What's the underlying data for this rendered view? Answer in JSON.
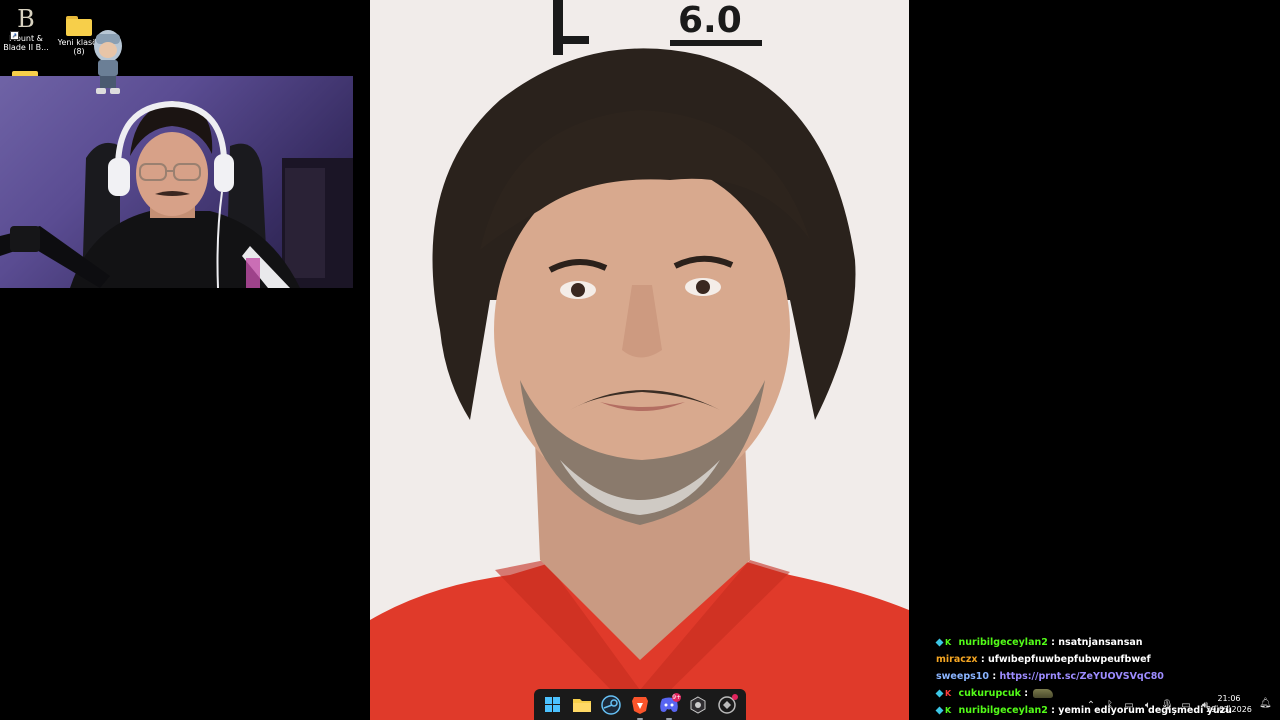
{
  "desktop": {
    "icons": [
      {
        "label": "Mount & Blade II B...",
        "icon": "mount-blade-icon"
      },
      {
        "label": "Yeni klasör (8)",
        "icon": "folder-icon"
      }
    ]
  },
  "chat": {
    "messages": [
      {
        "user": "nuribilgeceylan2",
        "user_color": "#53fc18",
        "badge": "kick-green",
        "sep": ":",
        "text": "nsatnjansansan"
      },
      {
        "user": "miraczx",
        "user_color": "#f5a623",
        "badge": "",
        "sep": ":",
        "text": "ufwıbepfıuwbepfubwpeufbwef"
      },
      {
        "user": "sweeps10",
        "user_color": "#8ab4ff",
        "badge": "",
        "sep": ":",
        "text": "https://prnt.sc/ZeYUOVSVqC80",
        "is_link": true
      },
      {
        "user": "cukurupcuk",
        "user_color": "#53fc18",
        "badge": "kick-red",
        "sep": ":",
        "text": "",
        "emote": "tank-emote"
      },
      {
        "user": "nuribilgeceylan2",
        "user_color": "#53fc18",
        "badge": "kick-green",
        "sep": ":",
        "text": "yemin ediyorum değişmedi yüzü"
      }
    ]
  },
  "taskbar": {
    "items": [
      {
        "name": "start-button",
        "icon": "windows-logo-icon"
      },
      {
        "name": "file-explorer",
        "icon": "folder-icon"
      },
      {
        "name": "steam",
        "icon": "steam-icon"
      },
      {
        "name": "brave",
        "icon": "brave-lion-icon"
      },
      {
        "name": "discord",
        "icon": "discord-icon",
        "badge": "9+"
      },
      {
        "name": "obs",
        "icon": "obs-icon"
      },
      {
        "name": "misc-app",
        "icon": "app-icon"
      }
    ]
  },
  "tray": {
    "icons": [
      "chevron-up-icon",
      "bluetooth-icon",
      "network-icon",
      "volume-icon",
      "mic-icon",
      "display-icon",
      "speaker-icon"
    ],
    "time": "21:06",
    "date": "29.03.2026"
  },
  "colors": {
    "link": "#9d8cff",
    "kick_green": "#53fc18",
    "shirt": "#e03a2a"
  }
}
